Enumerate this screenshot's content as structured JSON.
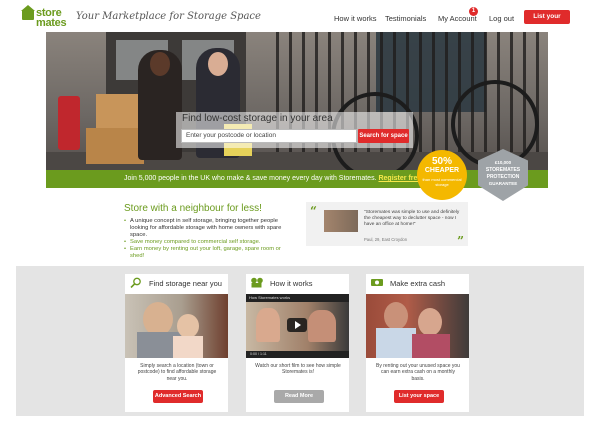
{
  "header": {
    "logo_line1": "store",
    "logo_line2": "mates",
    "tagline": "Your Marketplace for Storage Space",
    "nav": {
      "how_it_works": "How it works",
      "testimonials": "Testimonials",
      "my_account": "My Account",
      "notification_count": "1",
      "log_out": "Log out"
    },
    "list_button": "List your space"
  },
  "hero": {
    "search_title": "Find low-cost storage in your area",
    "search_placeholder": "Enter your postcode or location",
    "search_button": "Search for space"
  },
  "band": {
    "text": "Join 5,000 people in the UK who make & save money every day with Storemates.",
    "link": "Register free today"
  },
  "badges": {
    "cheaper_pct": "50%",
    "cheaper_word": "CHEAPER",
    "cheaper_small": "than most commercial storage",
    "guarantee_amount": "£10,000",
    "guarantee_line1": "STOREMATES",
    "guarantee_line2": "PROTECTION",
    "guarantee_line3": "GUARANTEE"
  },
  "neighbour": {
    "title": "Store with a neighbour for less!",
    "items": [
      "A unique concept in self storage, bringing together people looking for affordable storage with home owners with spare space.",
      "Save money compared to commercial self storage.",
      "Earn money by renting out your loft, garage, spare room or shed!"
    ]
  },
  "testimonial": {
    "quote": "\"Storemates was simple to use and definitely the cheapest way to declutter space - now I have an office at home!\"",
    "author": "Paul, 29, East Croydon"
  },
  "cards": [
    {
      "icon": "magnifier-icon",
      "title": "Find storage near you",
      "text": "Simply search a location (town or postcode) to find affordable storage near you.",
      "button": "Advanced Search"
    },
    {
      "icon": "film-reel-icon",
      "title": "How it works",
      "video_title": "How Storemates works",
      "video_time": "0:00 / 1:11",
      "text": "Watch our short film to see how simple Storemates is!",
      "button": "Read More"
    },
    {
      "icon": "cash-icon",
      "title": "Make extra cash",
      "text": "By renting out your unused space you can earn extra cash on a monthly basis.",
      "button": "List your space"
    }
  ],
  "colors": {
    "brand_green": "#6b9b1e",
    "accent_red": "#e02b2b",
    "badge_yellow": "#f4b800"
  }
}
